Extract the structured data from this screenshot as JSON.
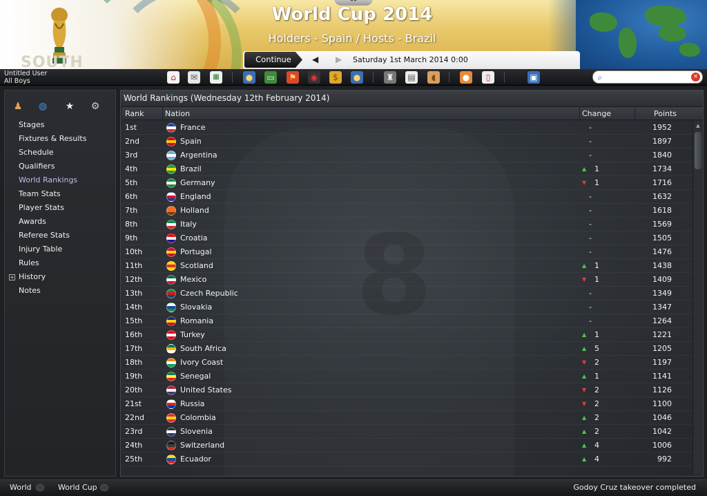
{
  "header": {
    "title": "World Cup 2014",
    "subtitle": "Holders - Spain / Hosts - Brazil",
    "watermark": "SOUTH",
    "continue_label": "Continue",
    "date": "Saturday 1st March 2014 0:00"
  },
  "user": {
    "name": "Untitled User",
    "profile": "All Boys"
  },
  "toolbar_icons": [
    "home-icon",
    "mail-icon",
    "calendar-icon",
    "squad-icon",
    "tactics-icon",
    "training-icon",
    "scouting-icon",
    "staff-icon",
    "finances-icon",
    "competitions-icon",
    "news-icon",
    "listen-icon",
    "manager-icon",
    "clipboard-icon",
    "computer-icon"
  ],
  "search": {
    "placeholder": ""
  },
  "sidebar": {
    "tabs": [
      "person-icon",
      "globe-icon",
      "star-icon",
      "settings-icon"
    ],
    "items": [
      {
        "label": "Stages"
      },
      {
        "label": "Fixtures & Results"
      },
      {
        "label": "Schedule"
      },
      {
        "label": "Qualifiers"
      },
      {
        "label": "World Rankings",
        "active": true
      },
      {
        "label": "Team Stats"
      },
      {
        "label": "Player Stats"
      },
      {
        "label": "Awards"
      },
      {
        "label": "Referee Stats"
      },
      {
        "label": "Injury Table"
      },
      {
        "label": "Rules"
      },
      {
        "label": "History"
      },
      {
        "label": "Notes"
      }
    ]
  },
  "panel": {
    "title": "World Rankings (Wednesday 12th February 2014)",
    "columns": {
      "rank": "Rank",
      "nation": "Nation",
      "change": "Change",
      "points": "Points"
    }
  },
  "rankings": [
    {
      "rank": "1st",
      "nation": "France",
      "dir": "none",
      "change": "-",
      "points": "1952",
      "colors": [
        "#1f3fa8",
        "#ffffff",
        "#d22b2b"
      ]
    },
    {
      "rank": "2nd",
      "nation": "Spain",
      "dir": "none",
      "change": "-",
      "points": "1897",
      "colors": [
        "#c60b1e",
        "#ffc400",
        "#c60b1e"
      ]
    },
    {
      "rank": "3rd",
      "nation": "Argentina",
      "dir": "none",
      "change": "-",
      "points": "1840",
      "colors": [
        "#74acdf",
        "#ffffff",
        "#74acdf"
      ]
    },
    {
      "rank": "4th",
      "nation": "Brazil",
      "dir": "up",
      "change": "1",
      "points": "1734",
      "colors": [
        "#1f9a3a",
        "#ffdf00",
        "#1f9a3a"
      ]
    },
    {
      "rank": "5th",
      "nation": "Germany",
      "dir": "down",
      "change": "1",
      "points": "1716",
      "colors": [
        "#1e8a3c",
        "#ffffff",
        "#1e8a3c"
      ]
    },
    {
      "rank": "6th",
      "nation": "England",
      "dir": "none",
      "change": "-",
      "points": "1632",
      "colors": [
        "#ffffff",
        "#cf142b",
        "#1f3a8a"
      ]
    },
    {
      "rank": "7th",
      "nation": "Holland",
      "dir": "none",
      "change": "-",
      "points": "1618",
      "colors": [
        "#f36c21",
        "#f36c21",
        "#7a3a10"
      ]
    },
    {
      "rank": "8th",
      "nation": "Italy",
      "dir": "none",
      "change": "-",
      "points": "1569",
      "colors": [
        "#009246",
        "#ffffff",
        "#ce2b37"
      ]
    },
    {
      "rank": "9th",
      "nation": "Croatia",
      "dir": "none",
      "change": "-",
      "points": "1505",
      "colors": [
        "#ff0000",
        "#ffffff",
        "#171796"
      ]
    },
    {
      "rank": "10th",
      "nation": "Portugal",
      "dir": "none",
      "change": "-",
      "points": "1476",
      "colors": [
        "#c8102e",
        "#ffd700",
        "#c8102e"
      ]
    },
    {
      "rank": "11th",
      "nation": "Scotland",
      "dir": "up",
      "change": "1",
      "points": "1438",
      "colors": [
        "#ffd200",
        "#e03030",
        "#ffd200"
      ]
    },
    {
      "rank": "12th",
      "nation": "Mexico",
      "dir": "down",
      "change": "1",
      "points": "1409",
      "colors": [
        "#006847",
        "#ffffff",
        "#ce1126"
      ]
    },
    {
      "rank": "13th",
      "nation": "Czech Republic",
      "dir": "none",
      "change": "-",
      "points": "1349",
      "colors": [
        "#1a8a3a",
        "#d7141a",
        "#11457e"
      ]
    },
    {
      "rank": "14th",
      "nation": "Slovakia",
      "dir": "none",
      "change": "-",
      "points": "1347",
      "colors": [
        "#ffffff",
        "#0b4ea2",
        "#1e8a3c"
      ]
    },
    {
      "rank": "15th",
      "nation": "Romania",
      "dir": "none",
      "change": "-",
      "points": "1264",
      "colors": [
        "#002b7f",
        "#fcd116",
        "#ce1126"
      ]
    },
    {
      "rank": "16th",
      "nation": "Turkey",
      "dir": "up",
      "change": "1",
      "points": "1221",
      "colors": [
        "#e30a17",
        "#ffffff",
        "#e30a17"
      ]
    },
    {
      "rank": "17th",
      "nation": "South Africa",
      "dir": "up",
      "change": "5",
      "points": "1205",
      "colors": [
        "#007a4d",
        "#ffb612",
        "#ffffff"
      ]
    },
    {
      "rank": "18th",
      "nation": "Ivory Coast",
      "dir": "down",
      "change": "2",
      "points": "1197",
      "colors": [
        "#f77f00",
        "#ffffff",
        "#009e60"
      ]
    },
    {
      "rank": "19th",
      "nation": "Senegal",
      "dir": "up",
      "change": "1",
      "points": "1141",
      "colors": [
        "#00853f",
        "#fdef42",
        "#e31b23"
      ]
    },
    {
      "rank": "20th",
      "nation": "United States",
      "dir": "down",
      "change": "2",
      "points": "1126",
      "colors": [
        "#b22234",
        "#ffffff",
        "#3c3b6e"
      ]
    },
    {
      "rank": "21st",
      "nation": "Russia",
      "dir": "down",
      "change": "2",
      "points": "1100",
      "colors": [
        "#ffffff",
        "#d52b1e",
        "#0039a6"
      ]
    },
    {
      "rank": "22nd",
      "nation": "Colombia",
      "dir": "up",
      "change": "2",
      "points": "1046",
      "colors": [
        "#e23030",
        "#fcd116",
        "#e23030"
      ]
    },
    {
      "rank": "23rd",
      "nation": "Slovenia",
      "dir": "up",
      "change": "2",
      "points": "1042",
      "colors": [
        "#333333",
        "#ffffff",
        "#1f3a8a"
      ]
    },
    {
      "rank": "24th",
      "nation": "Switzerland",
      "dir": "up",
      "change": "4",
      "points": "1006",
      "colors": [
        "#1a1a1a",
        "#3b3b3b",
        "#d52b1e"
      ]
    },
    {
      "rank": "25th",
      "nation": "Ecuador",
      "dir": "up",
      "change": "4",
      "points": "992",
      "colors": [
        "#ffdd00",
        "#034ea2",
        "#ed1c24"
      ]
    }
  ],
  "statusbar": {
    "tabs": [
      "World",
      "World Cup"
    ],
    "message": "Godoy Cruz takeover completed"
  }
}
